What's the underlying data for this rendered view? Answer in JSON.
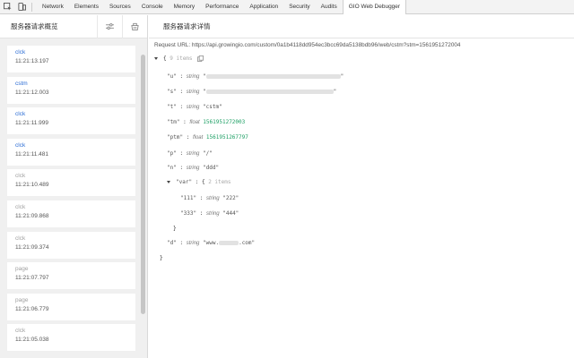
{
  "tabs": [
    "Network",
    "Elements",
    "Sources",
    "Console",
    "Memory",
    "Performance",
    "Application",
    "Security",
    "Audits",
    "GIO Web Debugger"
  ],
  "sidebar": {
    "title": "服务器请求概览",
    "items": [
      {
        "name": "clck",
        "time": "11:21:13.197",
        "muted": false
      },
      {
        "name": "cstm",
        "time": "11:21:12.003",
        "muted": false
      },
      {
        "name": "clck",
        "time": "11:21:11.999",
        "muted": false
      },
      {
        "name": "clck",
        "time": "11:21:11.481",
        "muted": false
      },
      {
        "name": "clck",
        "time": "11:21:10.489",
        "muted": true
      },
      {
        "name": "clck",
        "time": "11:21:09.868",
        "muted": true
      },
      {
        "name": "clck",
        "time": "11:21:09.374",
        "muted": true
      },
      {
        "name": "page",
        "time": "11:21:07.797",
        "muted": true
      },
      {
        "name": "page",
        "time": "11:21:06.779",
        "muted": true
      },
      {
        "name": "clck",
        "time": "11:21:05.038",
        "muted": true
      }
    ]
  },
  "main": {
    "title": "服务器请求详情",
    "request_url": "Request URL: https://api.growingio.com/custom/0a1b4118dd954ec3bcc69da5138bdb96/web/cstm?stm=1561951272004",
    "json": {
      "count": "9 items",
      "u": {
        "key": "\"u\"",
        "type": "string"
      },
      "s": {
        "key": "\"s\"",
        "type": "string"
      },
      "t": {
        "key": "\"t\"",
        "type": "string",
        "value": "\"cstm\""
      },
      "tm": {
        "key": "\"tm\"",
        "type": "float",
        "value": "1561951272003"
      },
      "ptm": {
        "key": "\"ptm\"",
        "type": "float",
        "value": "1561951267797"
      },
      "p": {
        "key": "\"p\"",
        "type": "string",
        "value": "\"/\""
      },
      "n": {
        "key": "\"n\"",
        "type": "string",
        "value": "\"ddd\""
      },
      "var": {
        "key": "\"var\"",
        "count": "2 items",
        "k1": {
          "key": "\"111\"",
          "type": "string",
          "value": "\"222\""
        },
        "k2": {
          "key": "\"333\"",
          "type": "string",
          "value": "\"444\""
        }
      },
      "d": {
        "key": "\"d\"",
        "type": "string",
        "prefix": "\"www.",
        "suffix": ".com\""
      },
      "colon": ":",
      "open": "{",
      "close": "}"
    }
  }
}
